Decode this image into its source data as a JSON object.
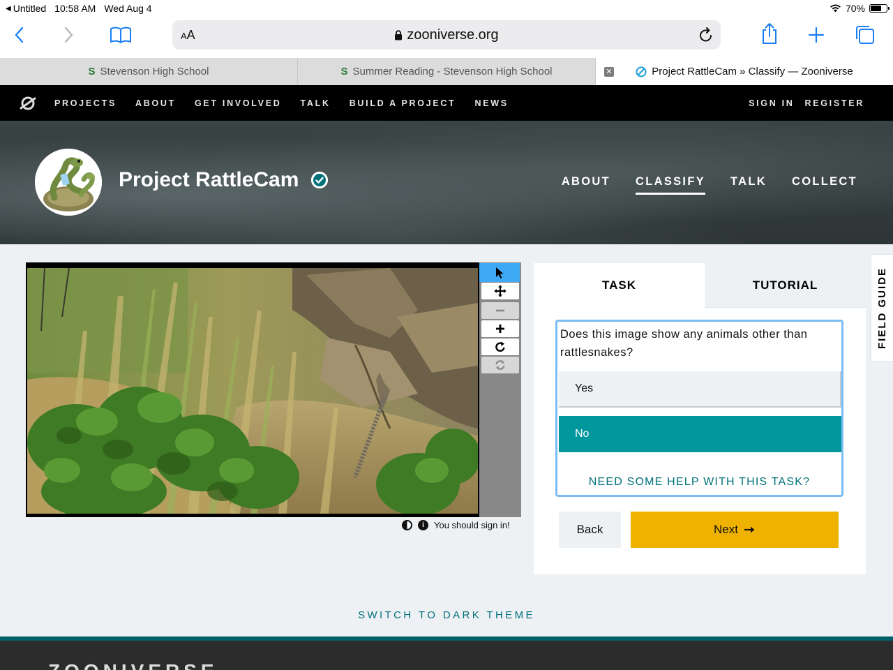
{
  "status_bar": {
    "back_app": "Untitled",
    "time": "10:58 AM",
    "date": "Wed Aug 4",
    "battery": "70%",
    "battery_level": 0.7
  },
  "browser": {
    "text_size_label": "AA",
    "address": "zooniverse.org",
    "tabs": [
      {
        "label": "Stevenson High School"
      },
      {
        "label": "Summer Reading - Stevenson High School"
      },
      {
        "label": "Project RattleCam » Classify — Zooniverse"
      }
    ]
  },
  "zooniverse_nav": {
    "links": [
      "PROJECTS",
      "ABOUT",
      "GET INVOLVED",
      "TALK",
      "BUILD A PROJECT",
      "NEWS"
    ],
    "sign_in": "SIGN IN",
    "register": "REGISTER"
  },
  "project": {
    "title": "Project RattleCam",
    "nav": [
      "ABOUT",
      "CLASSIFY",
      "TALK",
      "COLLECT"
    ],
    "active_nav": "CLASSIFY"
  },
  "viewer": {
    "sign_in_notice": "You should sign in!"
  },
  "task": {
    "tab_task": "TASK",
    "tab_tutorial": "TUTORIAL",
    "question": "Does this image show any animals other than rattlesnakes?",
    "answers": [
      "Yes",
      "No"
    ],
    "selected_answer": "No",
    "help_link": "NEED SOME HELP WITH THIS TASK?",
    "back_label": "Back",
    "next_label": "Next"
  },
  "field_guide_label": "FIELD GUIDE",
  "theme_switch_label": "SWITCH TO DARK THEME",
  "footer": {
    "brand": "ZOONIVERSE"
  },
  "colors": {
    "accent_teal": "#00979d",
    "next_yellow": "#f0b200",
    "safari_blue": "#1a7ef5",
    "active_tool": "#3eaaf5"
  }
}
